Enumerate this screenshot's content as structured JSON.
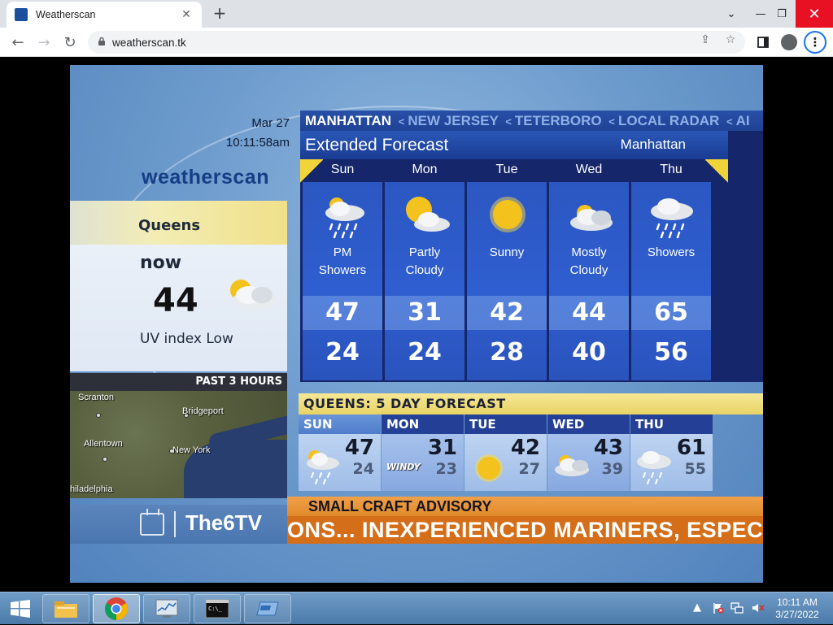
{
  "browser": {
    "tab_title": "Weatherscan",
    "tab_close": "✕",
    "new_tab": "+",
    "url": "weatherscan.tk",
    "window_controls": {
      "minimize": "—",
      "restore": "❐",
      "close": "✕",
      "tabs_menu": "⌄"
    }
  },
  "weather": {
    "date": "Mar 27",
    "time": "10:11:58am",
    "logo": "weatherscan",
    "current": {
      "city": "Queens",
      "label": "now",
      "temp": "44",
      "uv": "UV index Low"
    },
    "past_hours": "PAST 3 HOURS",
    "map_labels": [
      "Scranton",
      "Bridgeport",
      "Allentown",
      "New York",
      "hiladelphia"
    ],
    "brand": "The6TV",
    "breadcrumb": [
      "MANHATTAN",
      "NEW JERSEY",
      "TETERBORO",
      "LOCAL RADAR",
      "AI"
    ],
    "extended": {
      "title": "Extended Forecast",
      "location": "Manhattan",
      "days": [
        {
          "day": "Sun",
          "cond1": "PM",
          "cond2": "Showers",
          "hi": "47",
          "lo": "24",
          "icon": "showers-icon"
        },
        {
          "day": "Mon",
          "cond1": "Partly",
          "cond2": "Cloudy",
          "hi": "31",
          "lo": "24",
          "icon": "partly-cloudy-icon"
        },
        {
          "day": "Tue",
          "cond1": "Sunny",
          "cond2": "",
          "hi": "42",
          "lo": "28",
          "icon": "sunny-icon"
        },
        {
          "day": "Wed",
          "cond1": "Mostly",
          "cond2": "Cloudy",
          "hi": "44",
          "lo": "40",
          "icon": "mostly-cloudy-icon"
        },
        {
          "day": "Thu",
          "cond1": "Showers",
          "cond2": "",
          "hi": "65",
          "lo": "56",
          "icon": "showers-icon"
        }
      ]
    },
    "five_day": {
      "header": "QUEENS:   5 DAY FORECAST",
      "days": [
        {
          "day": "SUN",
          "hi": "47",
          "lo": "24",
          "icon": "showers-icon"
        },
        {
          "day": "MON",
          "hi": "31",
          "lo": "23",
          "icon": "windy-icon",
          "tag": "WINDY"
        },
        {
          "day": "TUE",
          "hi": "42",
          "lo": "27",
          "icon": "sunny-icon"
        },
        {
          "day": "WED",
          "hi": "43",
          "lo": "39",
          "icon": "mostly-cloudy-icon"
        },
        {
          "day": "THU",
          "hi": "61",
          "lo": "55",
          "icon": "showers-icon"
        }
      ]
    },
    "advisory": {
      "title": "SMALL CRAFT ADVISORY",
      "crawl": "ONS... INEXPERIENCED MARINERS, ESPEC"
    }
  },
  "taskbar": {
    "clock_time": "10:11 AM",
    "clock_date": "3/27/2022"
  },
  "colors": {
    "accent": "#1a73e8",
    "close_red": "#e81123",
    "advisory": "#d46e19",
    "forecast_blue": "#2b57c2"
  }
}
